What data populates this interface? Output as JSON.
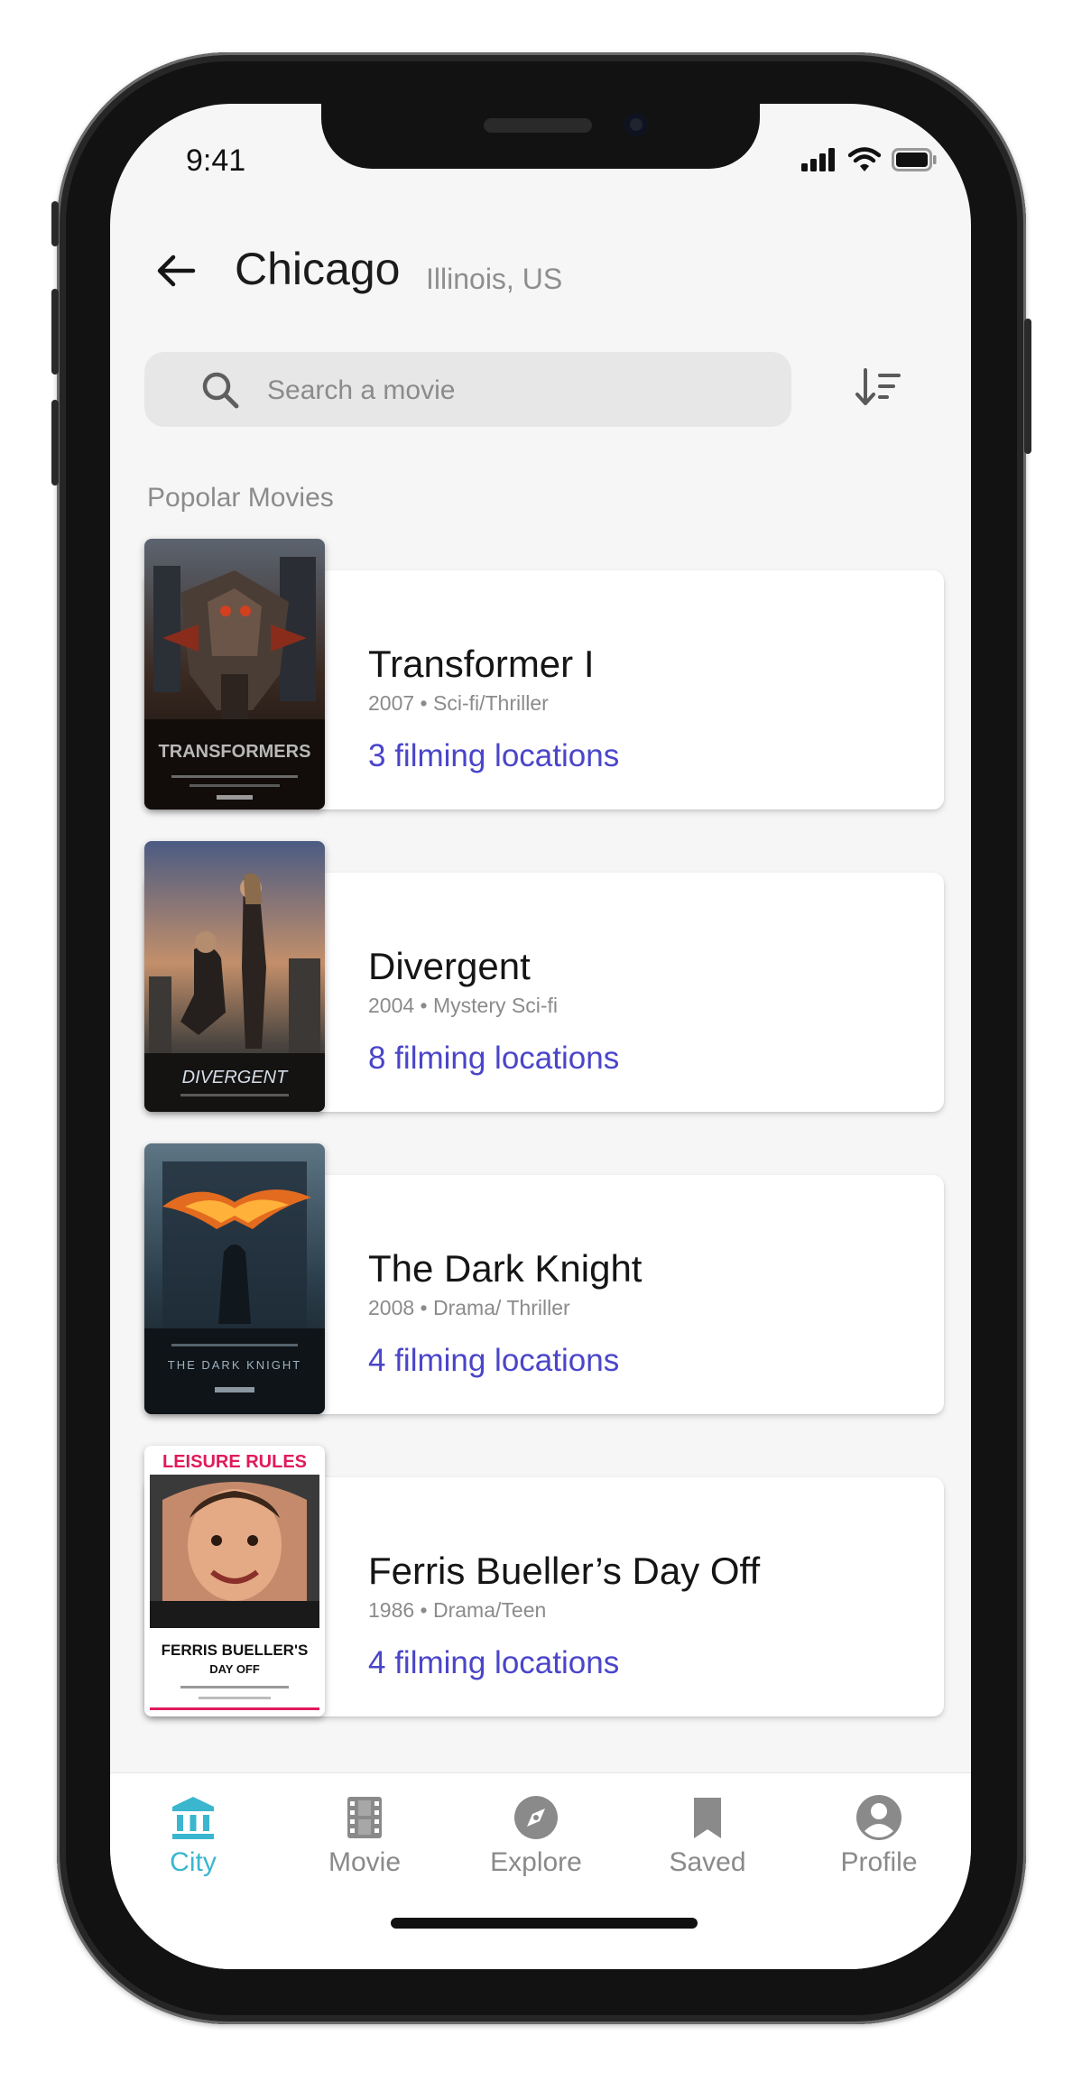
{
  "status_bar": {
    "time": "9:41"
  },
  "header": {
    "back_icon": "arrow-left-icon",
    "city": "Chicago",
    "region": "Illinois, US"
  },
  "search": {
    "placeholder": "Search a movie",
    "value": "",
    "icon": "search-icon"
  },
  "sort": {
    "icon": "sort-icon"
  },
  "section_label": "Popolar Movies",
  "movies": [
    {
      "title": "Transformer I",
      "meta": "2007 • Sci-fi/Thriller",
      "locations": "3 filming locations",
      "poster_text": "TRANSFORMERS"
    },
    {
      "title": "Divergent",
      "meta": "2004 • Mystery Sci-fi",
      "locations": "8 filming locations",
      "poster_text": "DIVERGENT"
    },
    {
      "title": "The Dark Knight",
      "meta": "2008 • Drama/ Thriller",
      "locations": "4 filming locations",
      "poster_text": "THE DARK KNIGHT"
    },
    {
      "title": "Ferris Bueller’s Day Off",
      "meta": "1986 • Drama/Teen",
      "locations": "4 filming locations",
      "poster_text_top": "LEISURE RULES",
      "poster_text_bottom": "FERRIS BUELLER'S",
      "poster_text_sub": "DAY OFF"
    }
  ],
  "tabs": [
    {
      "label": "City",
      "icon": "city-icon",
      "active": true
    },
    {
      "label": "Movie",
      "icon": "film-icon",
      "active": false
    },
    {
      "label": "Explore",
      "icon": "compass-icon",
      "active": false
    },
    {
      "label": "Saved",
      "icon": "bookmark-icon",
      "active": false
    },
    {
      "label": "Profile",
      "icon": "profile-icon",
      "active": false
    }
  ],
  "colors": {
    "accent": "#4a45c9",
    "tab_active": "#3ab6cf",
    "tab_inactive": "#8a8a8a",
    "background": "#f6f6f6"
  }
}
